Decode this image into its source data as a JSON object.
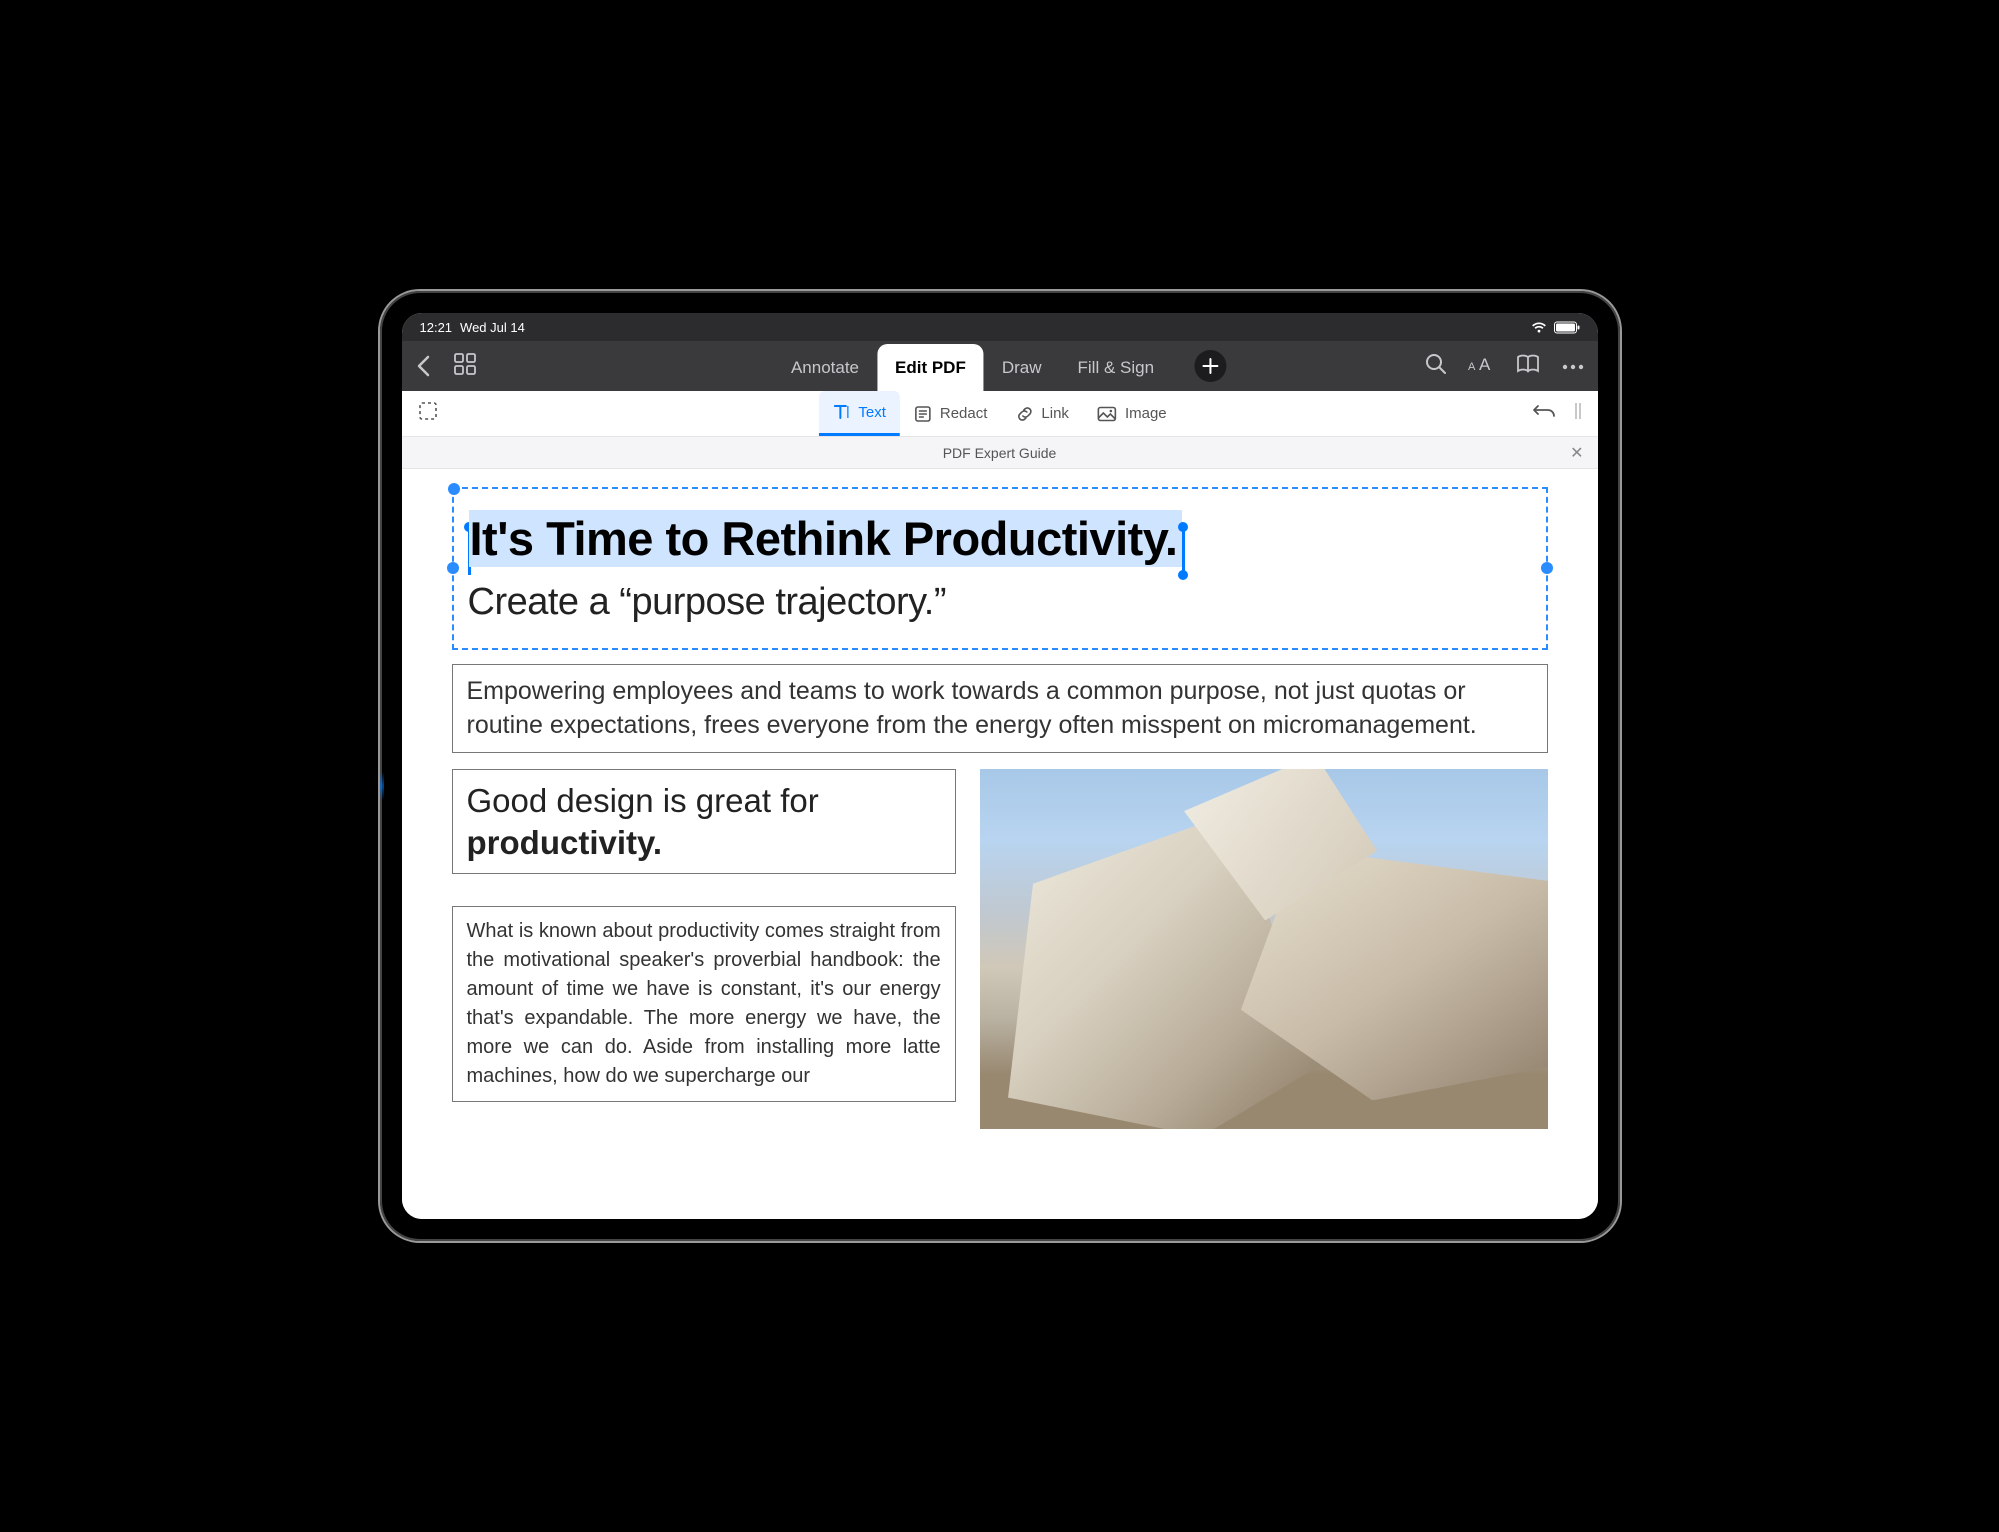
{
  "status": {
    "time": "12:21",
    "date": "Wed Jul 14"
  },
  "nav": {
    "tabs": [
      {
        "label": "Annotate"
      },
      {
        "label": "Edit PDF"
      },
      {
        "label": "Draw"
      },
      {
        "label": "Fill & Sign"
      }
    ],
    "active_tab_index": 1
  },
  "tools": {
    "items": [
      {
        "label": "Text"
      },
      {
        "label": "Redact"
      },
      {
        "label": "Link"
      },
      {
        "label": "Image"
      }
    ],
    "active_index": 0
  },
  "document": {
    "title": "PDF Expert Guide",
    "headline_selected": "It's Time to Rethink Productivity.",
    "subhead": "Create a “purpose trajectory.”",
    "intro": "Empowering employees and teams to work towards a common purpose, not just quotas or routine expectations, frees everyone from the energy often misspent on micromanagement.",
    "sub_heading_pre": "Good design is great for ",
    "sub_heading_bold": "productivity.",
    "body": "What is known about productivity comes straight from the motivational speaker's proverbial handbook: the amount of time we have is constant, it's our energy that's expandable. The more energy we have, the more we can do. Aside from installing more latte machines, how do we supercharge our"
  }
}
